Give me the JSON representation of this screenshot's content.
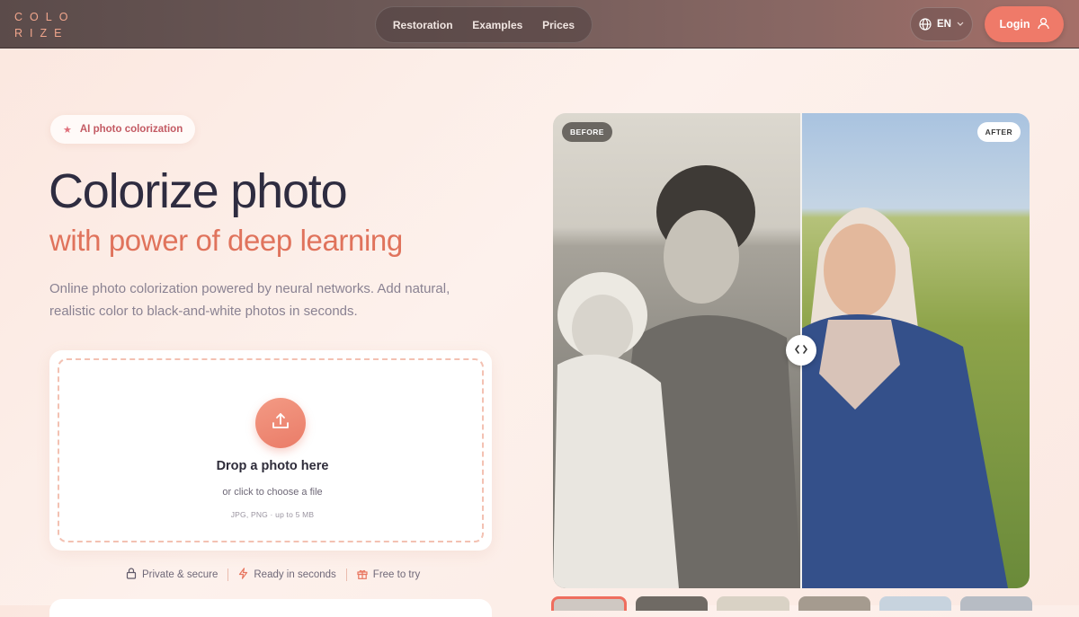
{
  "header": {
    "logo_line1": "COLO",
    "logo_line2": "RIZE",
    "nav": [
      "Restoration",
      "Examples",
      "Prices"
    ],
    "language": "EN",
    "login_label": "Login"
  },
  "hero": {
    "badge": "AI photo colorization",
    "title": "Colorize photo",
    "subtitle": "with power of deep learning",
    "description": "Online photo colorization powered by neural networks. Add natural, realistic color to black-and-white photos in seconds."
  },
  "upload": {
    "title": "Drop a photo here",
    "subtitle": "or click to choose a file",
    "formats": "JPG, PNG · up to 5 MB"
  },
  "features": [
    {
      "label": "Private & secure",
      "icon": "lock-icon"
    },
    {
      "label": "Ready in seconds",
      "icon": "lightning-icon"
    },
    {
      "label": "Free to try",
      "icon": "gift-icon"
    }
  ],
  "compare": {
    "before_label": "BEFORE",
    "after_label": "AFTER",
    "handle_icon": "arrows-horizontal-icon"
  },
  "colors": {
    "accent": "#ef7a69",
    "headline": "#2e2c40",
    "subheadline": "#e0735c"
  }
}
